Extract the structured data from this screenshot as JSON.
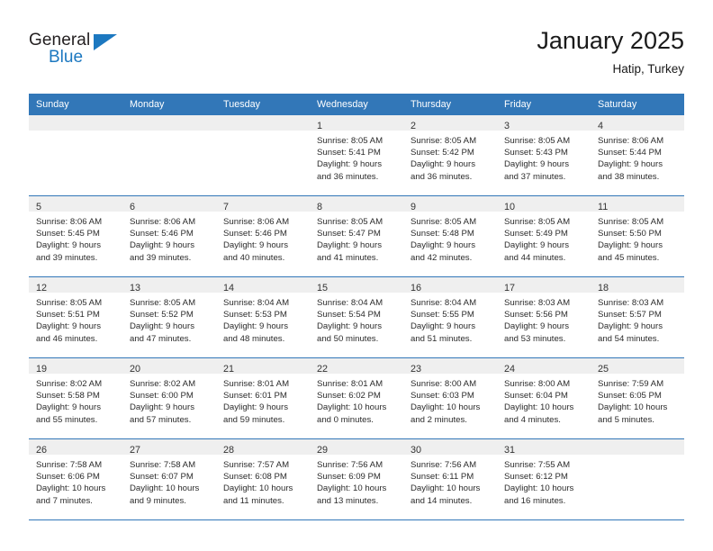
{
  "brand": {
    "name_part1": "General",
    "name_part2": "Blue",
    "logo_icon": "triangle-logo-icon"
  },
  "header": {
    "title": "January 2025",
    "subtitle": "Hatip, Turkey"
  },
  "colors": {
    "header_blue": "#3277b8",
    "brand_blue": "#1c78c0",
    "date_strip_gray": "#efefef",
    "text": "#2b2b2b"
  },
  "calendar": {
    "weekday_headers": [
      "Sunday",
      "Monday",
      "Tuesday",
      "Wednesday",
      "Thursday",
      "Friday",
      "Saturday"
    ],
    "weeks": [
      [
        {
          "day": "",
          "sunrise": "",
          "sunset": "",
          "daylight_line1": "",
          "daylight_line2": ""
        },
        {
          "day": "",
          "sunrise": "",
          "sunset": "",
          "daylight_line1": "",
          "daylight_line2": ""
        },
        {
          "day": "",
          "sunrise": "",
          "sunset": "",
          "daylight_line1": "",
          "daylight_line2": ""
        },
        {
          "day": "1",
          "sunrise": "Sunrise: 8:05 AM",
          "sunset": "Sunset: 5:41 PM",
          "daylight_line1": "Daylight: 9 hours",
          "daylight_line2": "and 36 minutes."
        },
        {
          "day": "2",
          "sunrise": "Sunrise: 8:05 AM",
          "sunset": "Sunset: 5:42 PM",
          "daylight_line1": "Daylight: 9 hours",
          "daylight_line2": "and 36 minutes."
        },
        {
          "day": "3",
          "sunrise": "Sunrise: 8:05 AM",
          "sunset": "Sunset: 5:43 PM",
          "daylight_line1": "Daylight: 9 hours",
          "daylight_line2": "and 37 minutes."
        },
        {
          "day": "4",
          "sunrise": "Sunrise: 8:06 AM",
          "sunset": "Sunset: 5:44 PM",
          "daylight_line1": "Daylight: 9 hours",
          "daylight_line2": "and 38 minutes."
        }
      ],
      [
        {
          "day": "5",
          "sunrise": "Sunrise: 8:06 AM",
          "sunset": "Sunset: 5:45 PM",
          "daylight_line1": "Daylight: 9 hours",
          "daylight_line2": "and 39 minutes."
        },
        {
          "day": "6",
          "sunrise": "Sunrise: 8:06 AM",
          "sunset": "Sunset: 5:46 PM",
          "daylight_line1": "Daylight: 9 hours",
          "daylight_line2": "and 39 minutes."
        },
        {
          "day": "7",
          "sunrise": "Sunrise: 8:06 AM",
          "sunset": "Sunset: 5:46 PM",
          "daylight_line1": "Daylight: 9 hours",
          "daylight_line2": "and 40 minutes."
        },
        {
          "day": "8",
          "sunrise": "Sunrise: 8:05 AM",
          "sunset": "Sunset: 5:47 PM",
          "daylight_line1": "Daylight: 9 hours",
          "daylight_line2": "and 41 minutes."
        },
        {
          "day": "9",
          "sunrise": "Sunrise: 8:05 AM",
          "sunset": "Sunset: 5:48 PM",
          "daylight_line1": "Daylight: 9 hours",
          "daylight_line2": "and 42 minutes."
        },
        {
          "day": "10",
          "sunrise": "Sunrise: 8:05 AM",
          "sunset": "Sunset: 5:49 PM",
          "daylight_line1": "Daylight: 9 hours",
          "daylight_line2": "and 44 minutes."
        },
        {
          "day": "11",
          "sunrise": "Sunrise: 8:05 AM",
          "sunset": "Sunset: 5:50 PM",
          "daylight_line1": "Daylight: 9 hours",
          "daylight_line2": "and 45 minutes."
        }
      ],
      [
        {
          "day": "12",
          "sunrise": "Sunrise: 8:05 AM",
          "sunset": "Sunset: 5:51 PM",
          "daylight_line1": "Daylight: 9 hours",
          "daylight_line2": "and 46 minutes."
        },
        {
          "day": "13",
          "sunrise": "Sunrise: 8:05 AM",
          "sunset": "Sunset: 5:52 PM",
          "daylight_line1": "Daylight: 9 hours",
          "daylight_line2": "and 47 minutes."
        },
        {
          "day": "14",
          "sunrise": "Sunrise: 8:04 AM",
          "sunset": "Sunset: 5:53 PM",
          "daylight_line1": "Daylight: 9 hours",
          "daylight_line2": "and 48 minutes."
        },
        {
          "day": "15",
          "sunrise": "Sunrise: 8:04 AM",
          "sunset": "Sunset: 5:54 PM",
          "daylight_line1": "Daylight: 9 hours",
          "daylight_line2": "and 50 minutes."
        },
        {
          "day": "16",
          "sunrise": "Sunrise: 8:04 AM",
          "sunset": "Sunset: 5:55 PM",
          "daylight_line1": "Daylight: 9 hours",
          "daylight_line2": "and 51 minutes."
        },
        {
          "day": "17",
          "sunrise": "Sunrise: 8:03 AM",
          "sunset": "Sunset: 5:56 PM",
          "daylight_line1": "Daylight: 9 hours",
          "daylight_line2": "and 53 minutes."
        },
        {
          "day": "18",
          "sunrise": "Sunrise: 8:03 AM",
          "sunset": "Sunset: 5:57 PM",
          "daylight_line1": "Daylight: 9 hours",
          "daylight_line2": "and 54 minutes."
        }
      ],
      [
        {
          "day": "19",
          "sunrise": "Sunrise: 8:02 AM",
          "sunset": "Sunset: 5:58 PM",
          "daylight_line1": "Daylight: 9 hours",
          "daylight_line2": "and 55 minutes."
        },
        {
          "day": "20",
          "sunrise": "Sunrise: 8:02 AM",
          "sunset": "Sunset: 6:00 PM",
          "daylight_line1": "Daylight: 9 hours",
          "daylight_line2": "and 57 minutes."
        },
        {
          "day": "21",
          "sunrise": "Sunrise: 8:01 AM",
          "sunset": "Sunset: 6:01 PM",
          "daylight_line1": "Daylight: 9 hours",
          "daylight_line2": "and 59 minutes."
        },
        {
          "day": "22",
          "sunrise": "Sunrise: 8:01 AM",
          "sunset": "Sunset: 6:02 PM",
          "daylight_line1": "Daylight: 10 hours",
          "daylight_line2": "and 0 minutes."
        },
        {
          "day": "23",
          "sunrise": "Sunrise: 8:00 AM",
          "sunset": "Sunset: 6:03 PM",
          "daylight_line1": "Daylight: 10 hours",
          "daylight_line2": "and 2 minutes."
        },
        {
          "day": "24",
          "sunrise": "Sunrise: 8:00 AM",
          "sunset": "Sunset: 6:04 PM",
          "daylight_line1": "Daylight: 10 hours",
          "daylight_line2": "and 4 minutes."
        },
        {
          "day": "25",
          "sunrise": "Sunrise: 7:59 AM",
          "sunset": "Sunset: 6:05 PM",
          "daylight_line1": "Daylight: 10 hours",
          "daylight_line2": "and 5 minutes."
        }
      ],
      [
        {
          "day": "26",
          "sunrise": "Sunrise: 7:58 AM",
          "sunset": "Sunset: 6:06 PM",
          "daylight_line1": "Daylight: 10 hours",
          "daylight_line2": "and 7 minutes."
        },
        {
          "day": "27",
          "sunrise": "Sunrise: 7:58 AM",
          "sunset": "Sunset: 6:07 PM",
          "daylight_line1": "Daylight: 10 hours",
          "daylight_line2": "and 9 minutes."
        },
        {
          "day": "28",
          "sunrise": "Sunrise: 7:57 AM",
          "sunset": "Sunset: 6:08 PM",
          "daylight_line1": "Daylight: 10 hours",
          "daylight_line2": "and 11 minutes."
        },
        {
          "day": "29",
          "sunrise": "Sunrise: 7:56 AM",
          "sunset": "Sunset: 6:09 PM",
          "daylight_line1": "Daylight: 10 hours",
          "daylight_line2": "and 13 minutes."
        },
        {
          "day": "30",
          "sunrise": "Sunrise: 7:56 AM",
          "sunset": "Sunset: 6:11 PM",
          "daylight_line1": "Daylight: 10 hours",
          "daylight_line2": "and 14 minutes."
        },
        {
          "day": "31",
          "sunrise": "Sunrise: 7:55 AM",
          "sunset": "Sunset: 6:12 PM",
          "daylight_line1": "Daylight: 10 hours",
          "daylight_line2": "and 16 minutes."
        },
        {
          "day": "",
          "sunrise": "",
          "sunset": "",
          "daylight_line1": "",
          "daylight_line2": ""
        }
      ]
    ]
  }
}
